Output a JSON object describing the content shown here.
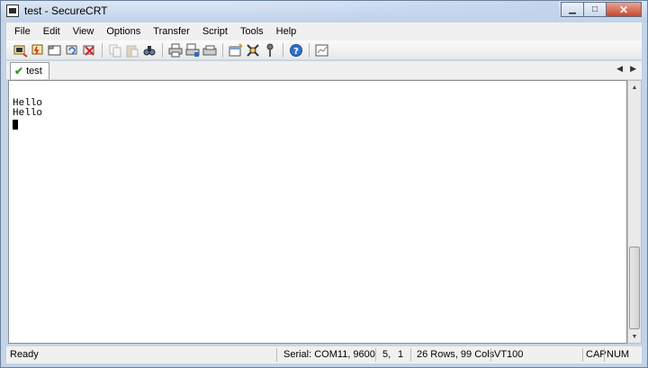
{
  "window": {
    "title": "test - SecureCRT"
  },
  "menu": [
    "File",
    "Edit",
    "View",
    "Options",
    "Transfer",
    "Script",
    "Tools",
    "Help"
  ],
  "toolbar": {
    "icons": [
      "connect-icon",
      "quick-connect-icon",
      "connect-tab-icon",
      "reconnect-icon",
      "disconnect-icon",
      "copy-icon",
      "paste-icon",
      "find-icon",
      "print-icon",
      "print-setup-icon",
      "print-screen-icon",
      "session-options-icon",
      "keymap-icon",
      "sftp-key-icon",
      "help-icon",
      "log-icon"
    ]
  },
  "tabs": [
    {
      "label": "test",
      "status": "connected"
    }
  ],
  "terminal": {
    "lines": [
      "Hello",
      "Hello"
    ]
  },
  "status": {
    "ready": "Ready",
    "serial": "Serial: COM11, 9600",
    "row": "5,",
    "col": "1",
    "size": "26 Rows,  99 Cols",
    "emulation": "VT100",
    "caps": "CAP",
    "num": "NUM"
  }
}
